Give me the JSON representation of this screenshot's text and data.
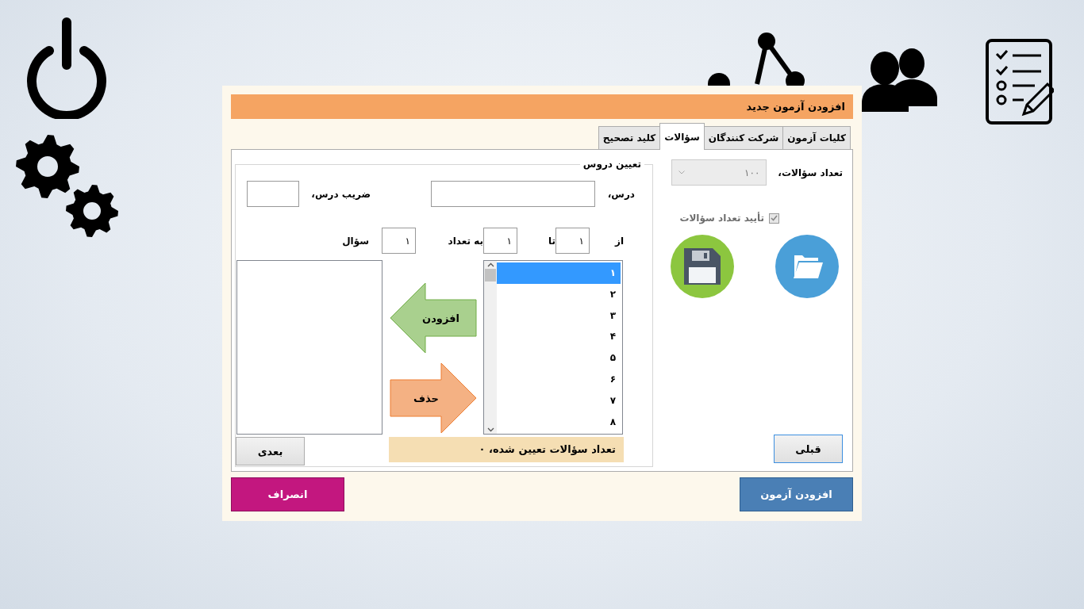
{
  "dialog": {
    "title": "افزودن آزمون جدید",
    "tabs": [
      {
        "label": "کلیات آزمون",
        "selected": false
      },
      {
        "label": "شرکت کنندگان",
        "selected": false
      },
      {
        "label": "سؤالات",
        "selected": true
      },
      {
        "label": "کلید تصحیح",
        "selected": false
      }
    ],
    "question_count": {
      "label": "تعداد سؤالات،",
      "value": "۱۰۰",
      "disabled": true
    },
    "confirm_checkbox": {
      "label": "تأیید تعداد سؤالات",
      "checked": true,
      "disabled": true
    },
    "previous_button": "قبلی",
    "lessons_group": {
      "title": "تعیین دروس",
      "lesson_label": "درس،",
      "weight_label": "ضریب درس،",
      "from_label": "از",
      "from_value": "۱",
      "to_label": "تا",
      "to_value": "۱",
      "count_label": "به تعداد",
      "count_value": "۱",
      "question_label": "سؤال",
      "questions": [
        {
          "label": "۱",
          "selected": true
        },
        {
          "label": "۲",
          "selected": false
        },
        {
          "label": "۳",
          "selected": false
        },
        {
          "label": "۴",
          "selected": false
        },
        {
          "label": "۵",
          "selected": false
        },
        {
          "label": "۶",
          "selected": false
        },
        {
          "label": "۷",
          "selected": false
        },
        {
          "label": "۸",
          "selected": false
        }
      ],
      "add_button": "افزودن",
      "remove_button": "حذف",
      "assigned_count": "تعداد سؤالات تعیین شده، ۰",
      "next_button": "بعدی"
    },
    "submit_button": "افزودن آزمون",
    "cancel_button": "انصراف"
  }
}
